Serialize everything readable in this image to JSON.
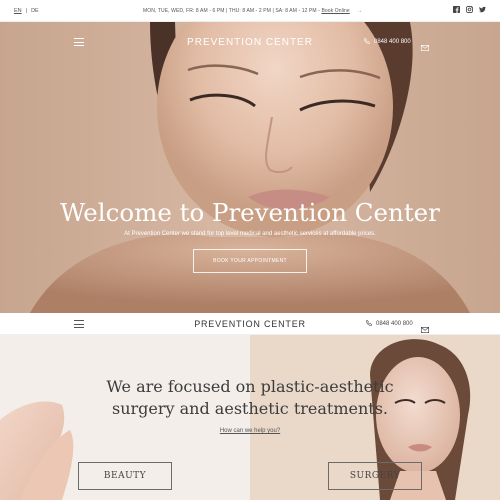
{
  "topbar": {
    "lang_en": "EN",
    "lang_sep": "|",
    "lang_de": "DE",
    "hours_text": "MON, TUE, WED, FR: 8 AM - 6 PM  |  THU: 8 AM - 2 PM  |  SA: 8 AM - 12 PM - ",
    "book_online": "Book Online",
    "arrow": "→",
    "social": [
      "facebook-icon",
      "instagram-icon",
      "twitter-icon"
    ]
  },
  "hero": {
    "brand": "PREVENTION CENTER",
    "phone": "0848 400 800",
    "title": "Welcome to Prevention Center",
    "subtitle": "At Prevention Center we stand for top level medical and aesthetic services at affordable prices.",
    "cta": "BOOK YOUR APPOINTMENT"
  },
  "nav2": {
    "brand": "PREVENTION CENTER",
    "phone": "0848 400 800"
  },
  "lower": {
    "title_line1": "We are focused on plastic-aesthetic",
    "title_line2": "surgery and aesthetic treatments.",
    "help_link": "How can we help you?",
    "beauty": "BEAUTY",
    "surgery": "SURGERY"
  },
  "colors": {
    "hero_skin": "#c9a48c",
    "lower_left_bg": "#f3eeea",
    "lower_right_bg": "#ead8c9"
  }
}
